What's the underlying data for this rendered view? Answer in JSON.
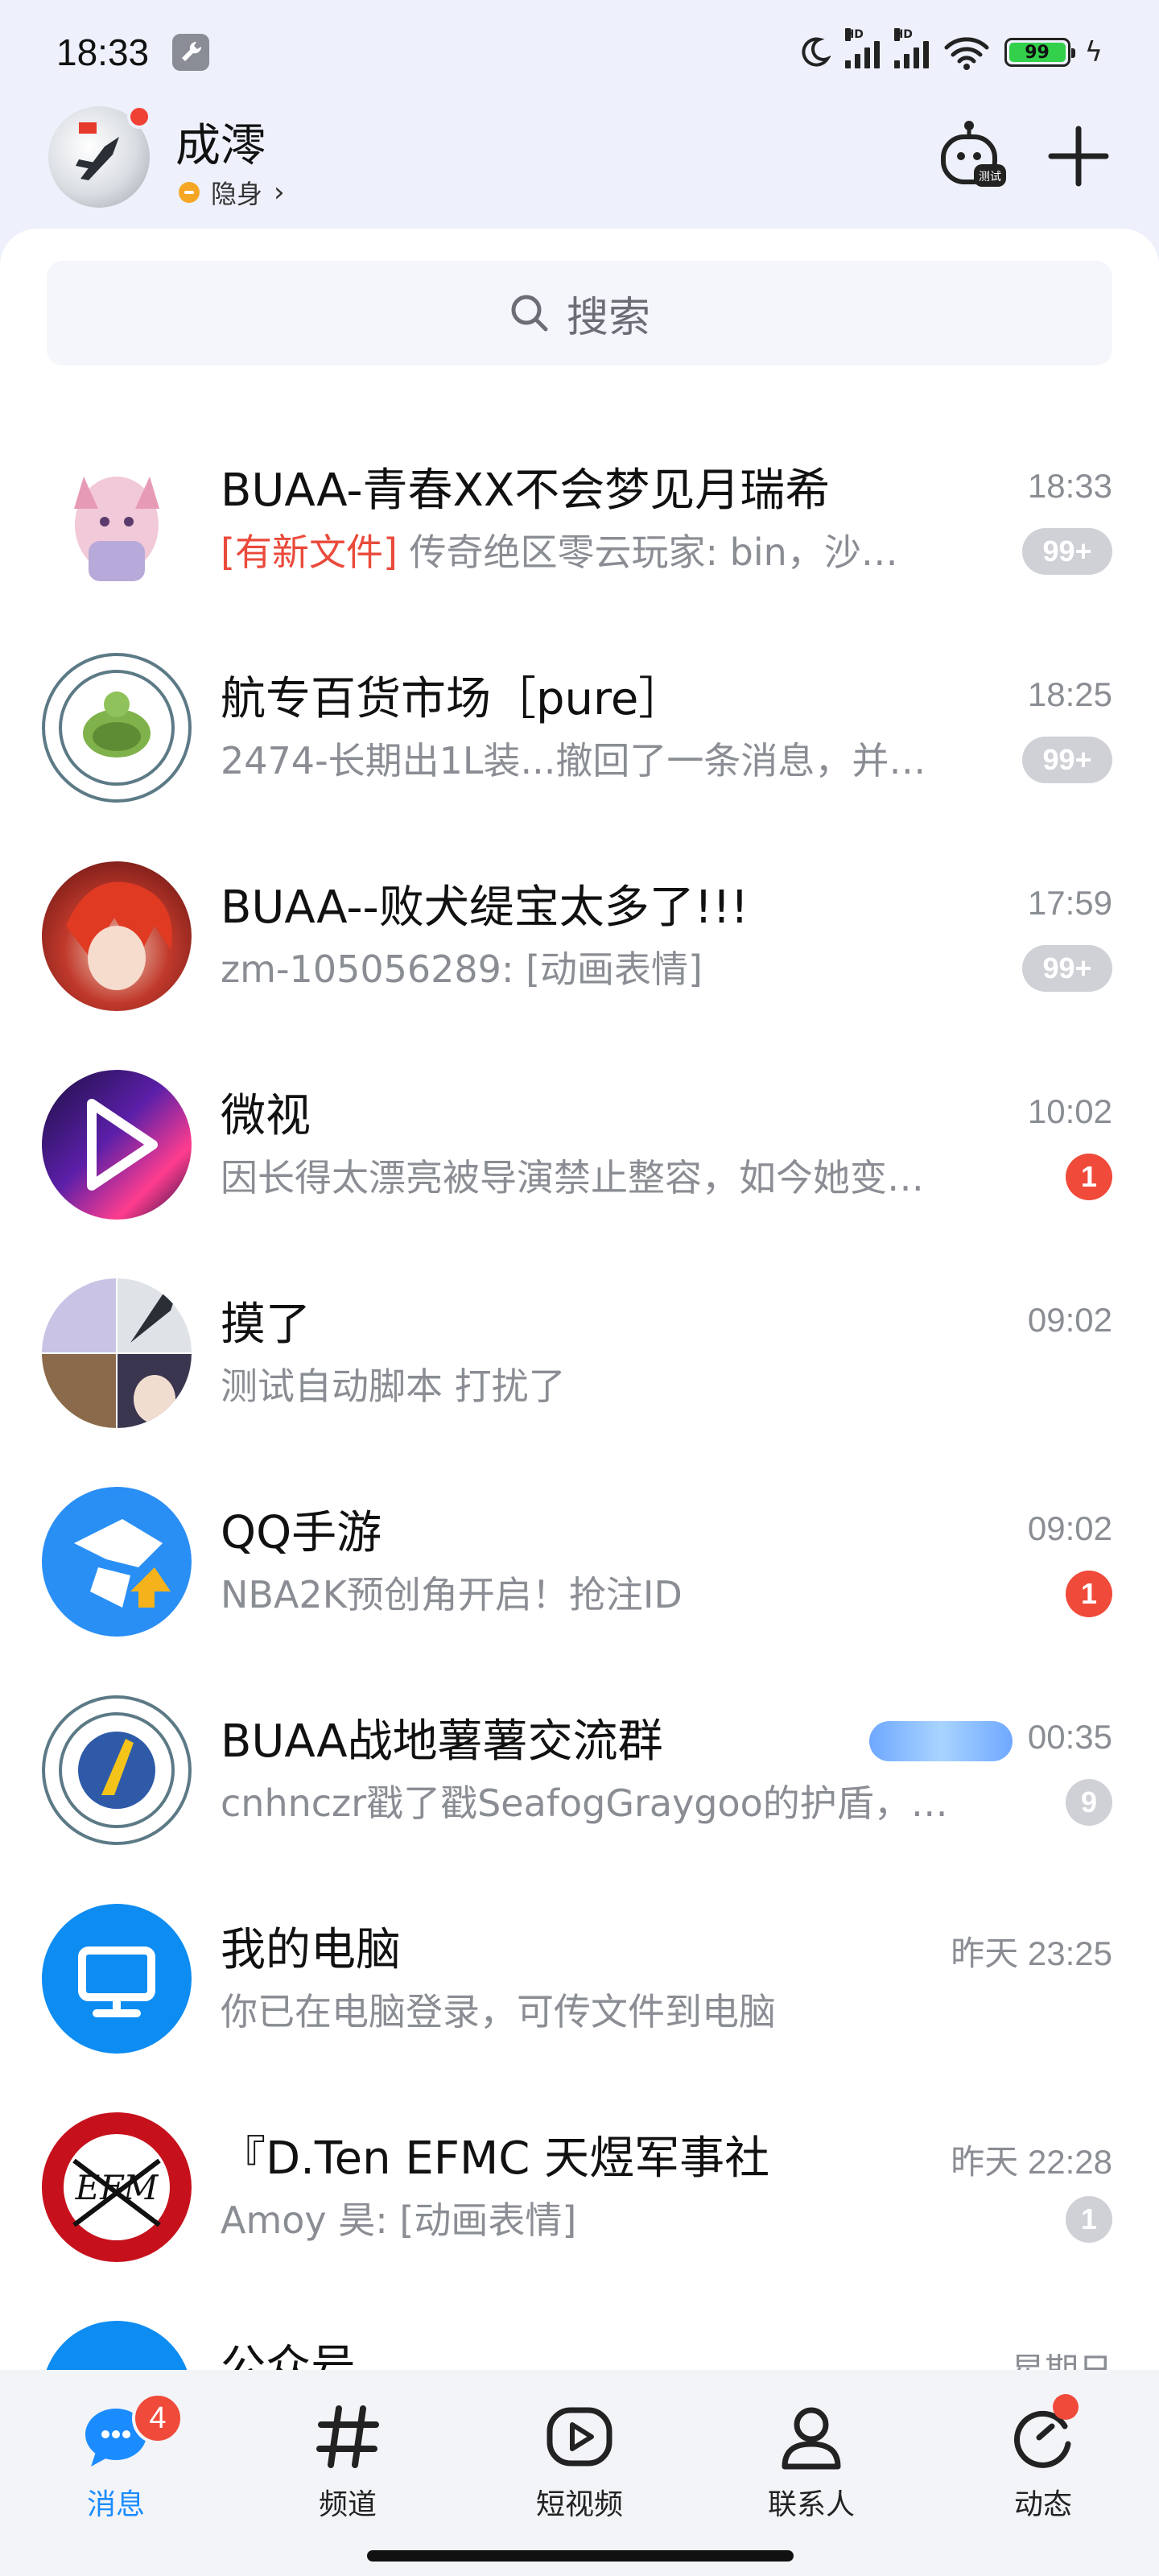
{
  "status_bar": {
    "time": "18:33",
    "battery": "99",
    "network_1": "HD",
    "network_2": "HD"
  },
  "profile": {
    "name": "成澪",
    "status": "隐身"
  },
  "header_icons": {
    "robot": "robot-test-icon",
    "plus": "plus-icon",
    "robot_label": "测试"
  },
  "search": {
    "placeholder": "搜索"
  },
  "conversations": [
    {
      "title": "BUAA-青春XX不会梦见月瑞希",
      "tag": "[有新文件]",
      "preview": " 传奇绝区零云玩家: bin，沙…",
      "time": "18:33",
      "badge": "99+"
    },
    {
      "title": "航专百货市场［pure］",
      "tag": "",
      "preview": "2474-长期出1L装...撤回了一条消息，并…",
      "time": "18:25",
      "badge": "99+"
    },
    {
      "title": "BUAA--败犬缇宝太多了!!!",
      "tag": "",
      "preview": "zm-105056289: [动画表情]",
      "time": "17:59",
      "badge": "99+"
    },
    {
      "title": "微视",
      "tag": "",
      "preview": "因长得太漂亮被导演禁止整容，如今她变…",
      "time": "10:02",
      "badge": "1"
    },
    {
      "title": "摸了",
      "tag": "",
      "preview": "测试自动脚本 打扰了",
      "time": "09:02",
      "badge": ""
    },
    {
      "title": "QQ手游",
      "tag": "",
      "preview": "NBA2K预创角开启！抢注ID",
      "time": "09:02",
      "badge": "1"
    },
    {
      "title": "BUAA战地薯薯交流群",
      "tag": "",
      "preview": "cnhnczr戳了戳SeafogGraygoo的护盾，…",
      "time": "00:35",
      "badge": "9"
    },
    {
      "title": "我的电脑",
      "tag": "",
      "preview": "你已在电脑登录，可传文件到电脑",
      "time": "昨天 23:25",
      "badge": ""
    },
    {
      "title": "『D.Ten EFMC 天煜军事社",
      "tag": "",
      "preview": "Amoy 昊: [动画表情]",
      "time": "昨天 22:28",
      "badge": "1"
    },
    {
      "title": "公众号",
      "tag": "",
      "preview": "",
      "time": "星期日",
      "badge": ""
    }
  ],
  "tabs": [
    {
      "label": "消息",
      "icon": "message-icon",
      "badge": "4"
    },
    {
      "label": "频道",
      "icon": "hashtag-icon"
    },
    {
      "label": "短视频",
      "icon": "play-icon"
    },
    {
      "label": "联系人",
      "icon": "person-icon"
    },
    {
      "label": "动态",
      "icon": "refresh-icon"
    }
  ],
  "colors": {
    "accent": "#1a8cff",
    "badge_red": "#f04a3a",
    "badge_gray": "#cfd1d6",
    "new_file_tag": "#ea4a3b"
  }
}
